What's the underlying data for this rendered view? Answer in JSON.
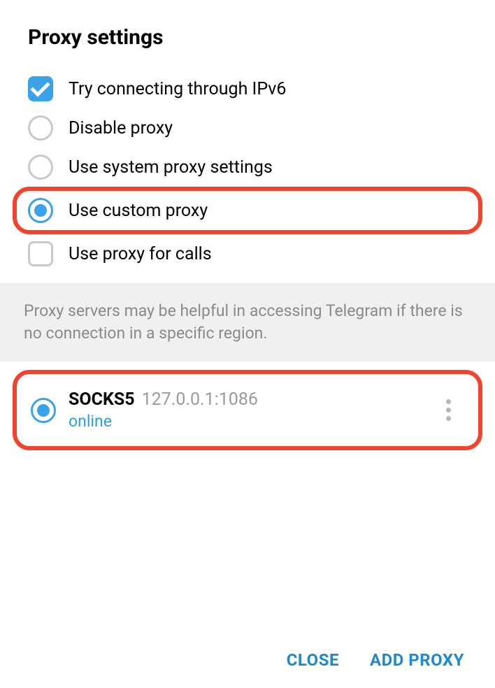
{
  "title": "Proxy settings",
  "options": [
    {
      "type": "checkbox",
      "checked": true,
      "label": "Try connecting through IPv6",
      "highlight": false
    },
    {
      "type": "radio",
      "checked": false,
      "label": "Disable proxy",
      "highlight": false
    },
    {
      "type": "radio",
      "checked": false,
      "label": "Use system proxy settings",
      "highlight": false
    },
    {
      "type": "radio",
      "checked": true,
      "label": "Use custom proxy",
      "highlight": true
    },
    {
      "type": "checkbox",
      "checked": false,
      "label": "Use proxy for calls",
      "highlight": false
    }
  ],
  "info_text": "Proxy servers may be helpful in accessing Telegram if there is no connection in a specific region.",
  "proxies": [
    {
      "selected": true,
      "proto": "SOCKS5",
      "address": "127.0.0.1:1086",
      "status": "online",
      "highlight": true
    }
  ],
  "footer": {
    "close": "CLOSE",
    "add": "ADD PROXY"
  }
}
